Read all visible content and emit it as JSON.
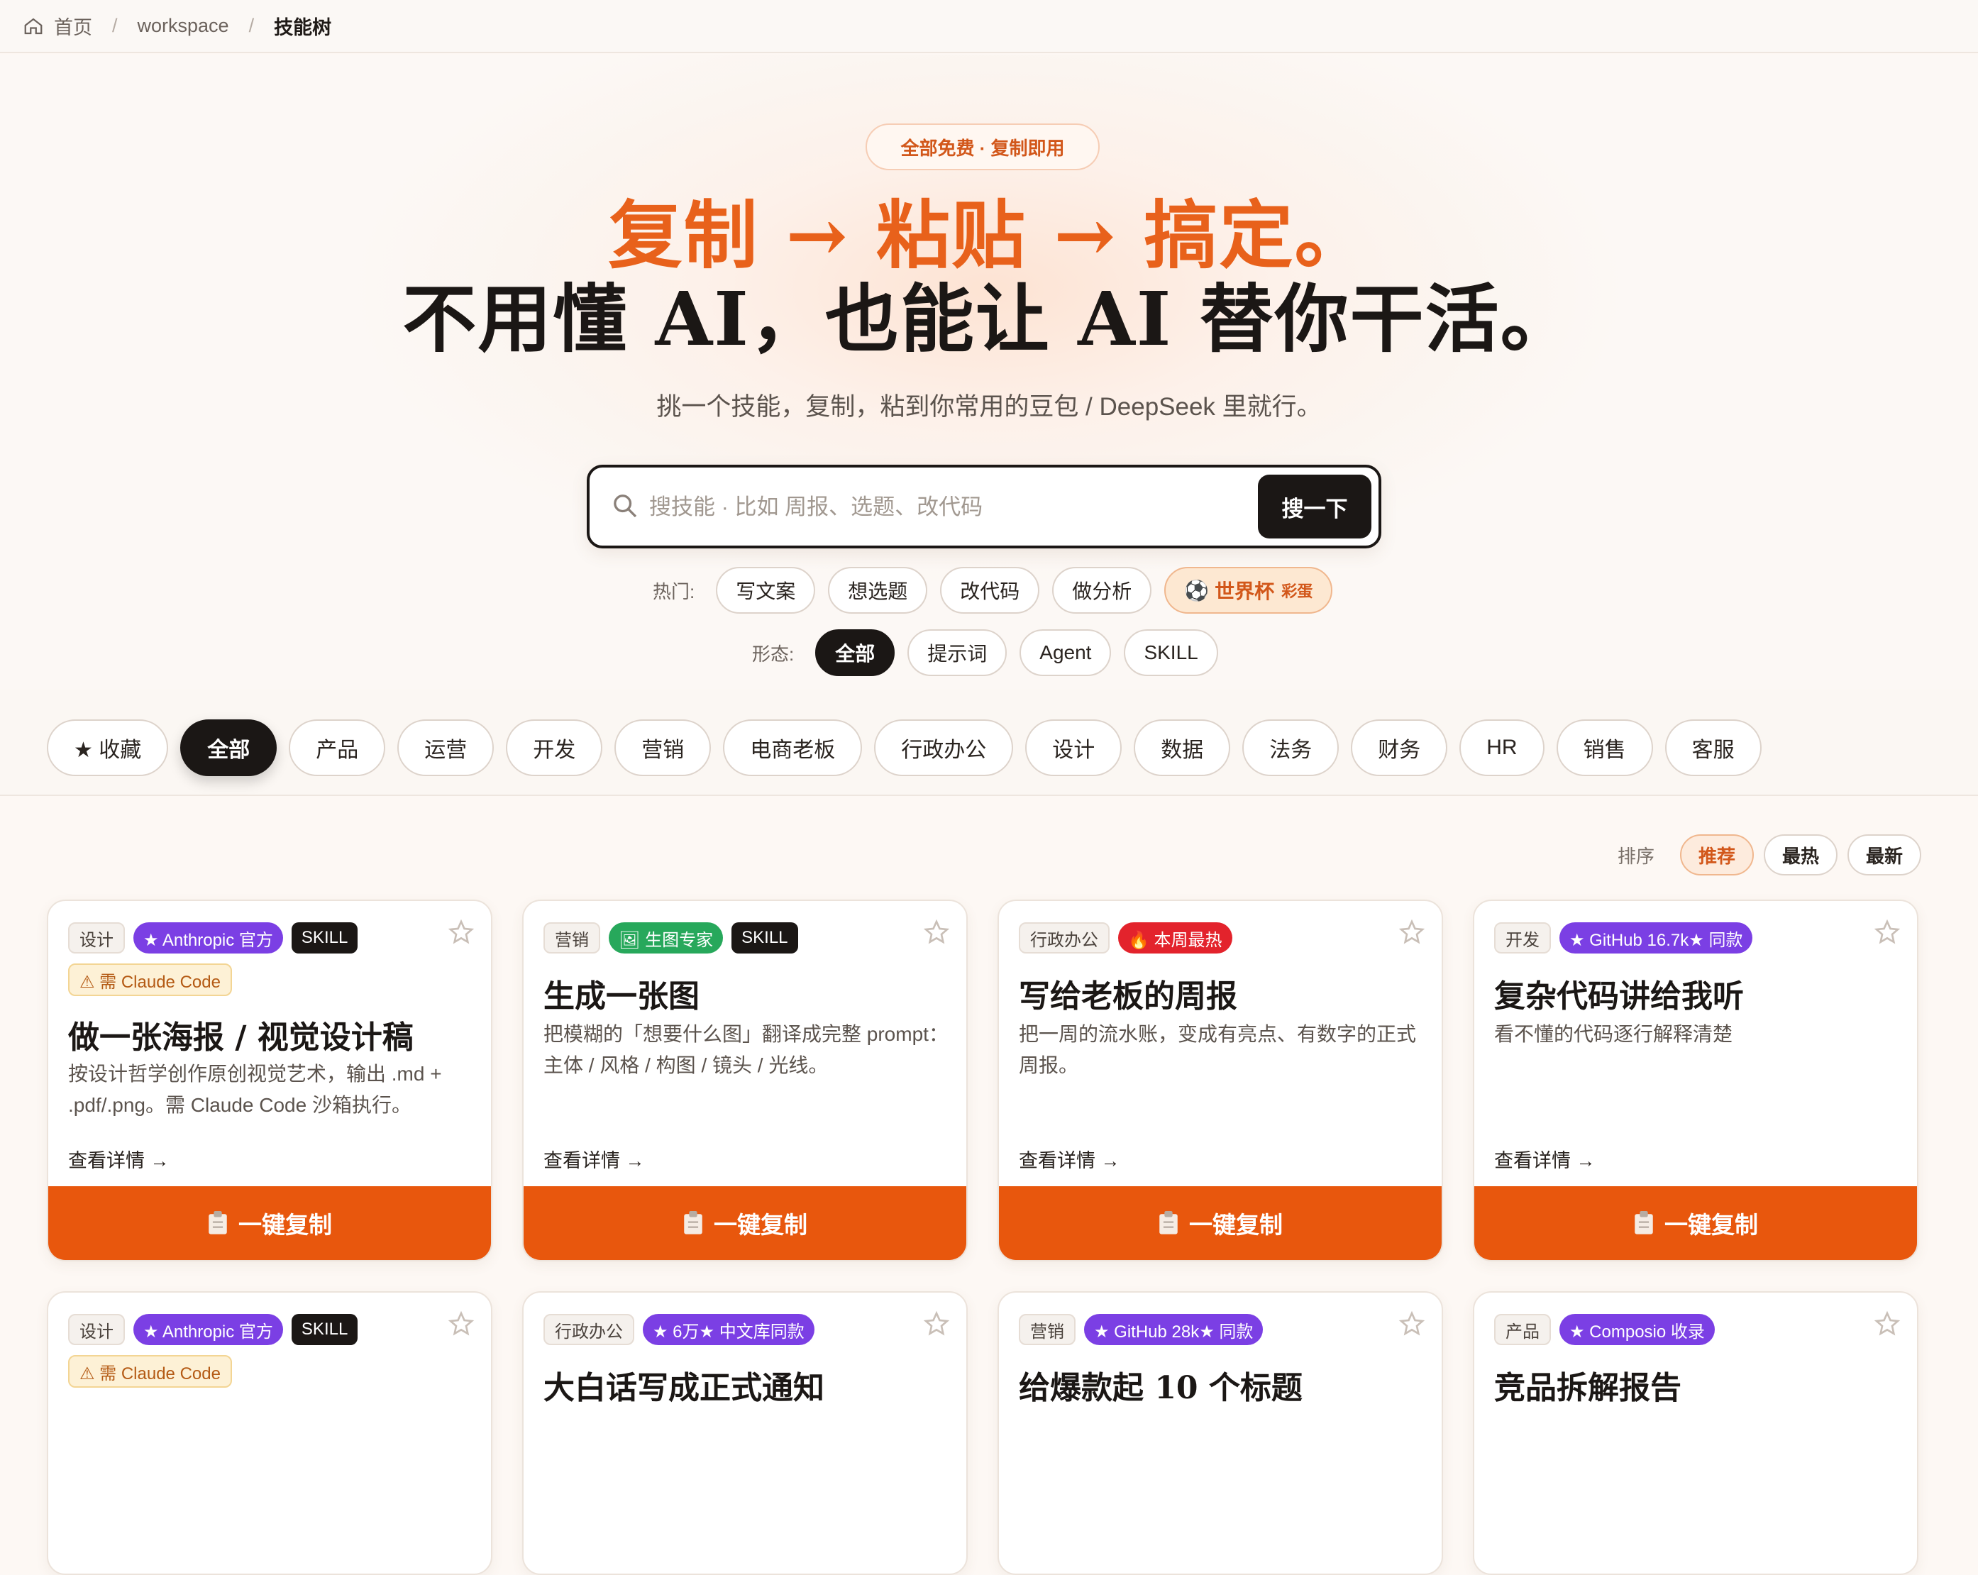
{
  "breadcrumb": {
    "home": "首页",
    "workspace": "workspace",
    "current": "技能树",
    "sep": "/"
  },
  "hero": {
    "badge": "全部免费 · 复制即用",
    "headline1": "复制 → 粘贴 → 搞定。",
    "headline2": "不用懂 AI，也能让 AI 替你干活。",
    "subtitle": "挑一个技能，复制，粘到你常用的豆包 / DeepSeek 里就行。"
  },
  "search": {
    "placeholder": "搜技能 · 比如 周报、选题、改代码",
    "button": "搜一下"
  },
  "hot": {
    "label": "热门:",
    "chips": [
      "写文案",
      "想选题",
      "改代码",
      "做分析"
    ],
    "worldcup": {
      "icon": "⚽",
      "label": "世界杯",
      "egg": "彩蛋"
    }
  },
  "form": {
    "label": "形态:",
    "options": [
      "全部",
      "提示词",
      "Agent",
      "SKILL"
    ]
  },
  "categories": [
    "★ 收藏",
    "全部",
    "产品",
    "运营",
    "开发",
    "营销",
    "电商老板",
    "行政办公",
    "设计",
    "数据",
    "法务",
    "财务",
    "HR",
    "销售",
    "客服"
  ],
  "sort": {
    "label": "排序",
    "options": [
      "推荐",
      "最热",
      "最新"
    ]
  },
  "copy_label": "一键复制",
  "detail_label": "查看详情 →",
  "cards": [
    {
      "category": "设计",
      "badge": "★ Anthropic 官方",
      "badge_type": "purple",
      "skill": "SKILL",
      "warn": "⚠ 需 Claude Code",
      "title": "做一张海报 / 视觉设计稿",
      "desc": "按设计哲学创作原创视觉艺术，输出 .md + .pdf/.png。需 Claude Code 沙箱执行。"
    },
    {
      "category": "营销",
      "badge": "🖼 生图专家",
      "badge_type": "green",
      "skill": "SKILL",
      "title": "生成一张图",
      "desc": "把模糊的「想要什么图」翻译成完整 prompt：主体 / 风格 / 构图 / 镜头 / 光线。"
    },
    {
      "category": "行政办公",
      "badge": "🔥 本周最热",
      "badge_type": "red",
      "title": "写给老板的周报",
      "desc": "把一周的流水账，变成有亮点、有数字的正式周报。"
    },
    {
      "category": "开发",
      "badge": "★ GitHub 16.7k★ 同款",
      "badge_type": "purple",
      "title": "复杂代码讲给我听",
      "desc": "看不懂的代码逐行解释清楚"
    },
    {
      "category": "设计",
      "badge": "★ Anthropic 官方",
      "badge_type": "purple",
      "skill": "SKILL",
      "warn": "⚠ 需 Claude Code",
      "title": "",
      "desc": ""
    },
    {
      "category": "行政办公",
      "badge": "★ 6万★ 中文库同款",
      "badge_type": "purple",
      "title": "大白话写成正式通知",
      "desc": ""
    },
    {
      "category": "营销",
      "badge": "★ GitHub 28k★ 同款",
      "badge_type": "purple",
      "title": "给爆款起 10 个标题",
      "desc": ""
    },
    {
      "category": "产品",
      "badge": "★ Composio 收录",
      "badge_type": "purple",
      "title": "竞品拆解报告",
      "desc": ""
    }
  ],
  "colors": {
    "accent": "#e8570d",
    "headline_orange": "#e8611b",
    "dark": "#1b1715",
    "badge_purple": "#7b3fe4"
  }
}
